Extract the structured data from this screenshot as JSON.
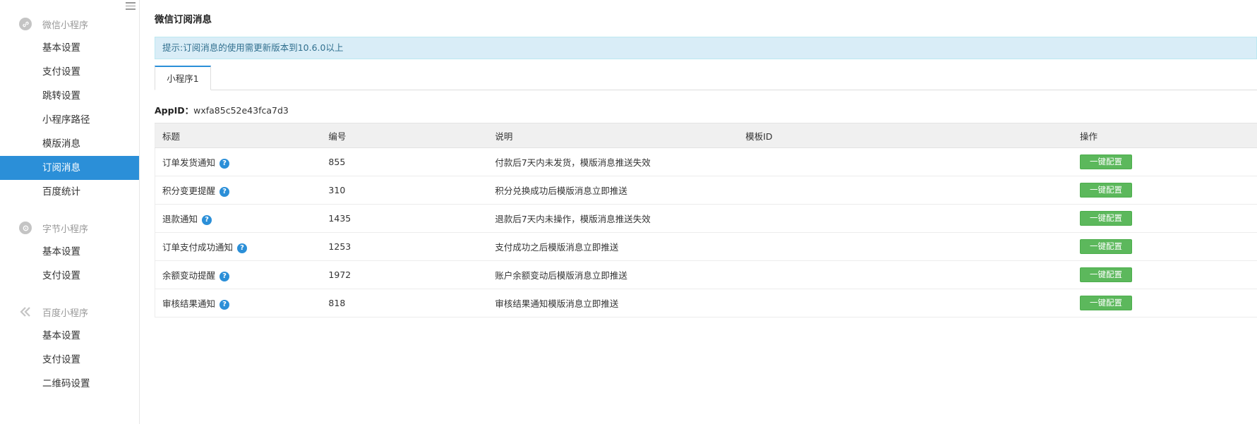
{
  "sidebar": {
    "groups": [
      {
        "title": "微信小程序",
        "icon": "link-icon",
        "items": [
          "基本设置",
          "支付设置",
          "跳转设置",
          "小程序路径",
          "模版消息",
          "订阅消息",
          "百度统计"
        ]
      },
      {
        "title": "字节小程序",
        "icon": "bytedance-icon",
        "items": [
          "基本设置",
          "支付设置"
        ]
      },
      {
        "title": "百度小程序",
        "icon": "baidu-chevron-icon",
        "items": [
          "基本设置",
          "支付设置",
          "二维码设置"
        ]
      }
    ],
    "active_item": "订阅消息"
  },
  "page": {
    "title": "微信订阅消息",
    "tip": "提示:订阅消息的使用需更新版本到10.6.0以上",
    "tabs": [
      "小程序1"
    ],
    "appid_label": "AppID：",
    "appid_value": "wxfa85c52e43fca7d3"
  },
  "table": {
    "headers": [
      "标题",
      "编号",
      "说明",
      "模板ID",
      "操作"
    ],
    "rows": [
      {
        "title": "订单发货通知",
        "id": "855",
        "desc": "付款后7天内未发货，模版消息推送失效",
        "template_id": "",
        "action": "一键配置"
      },
      {
        "title": "积分变更提醒",
        "id": "310",
        "desc": "积分兑换成功后模版消息立即推送",
        "template_id": "",
        "action": "一键配置"
      },
      {
        "title": "退款通知",
        "id": "1435",
        "desc": "退款后7天内未操作，模版消息推送失效",
        "template_id": "",
        "action": "一键配置"
      },
      {
        "title": "订单支付成功通知",
        "id": "1253",
        "desc": "支付成功之后模版消息立即推送",
        "template_id": "",
        "action": "一键配置"
      },
      {
        "title": "余额变动提醒",
        "id": "1972",
        "desc": "账户余额变动后模版消息立即推送",
        "template_id": "",
        "action": "一键配置"
      },
      {
        "title": "审核结果通知",
        "id": "818",
        "desc": "审核结果通知模版消息立即推送",
        "template_id": "",
        "action": "一键配置"
      }
    ],
    "help_glyph": "?"
  },
  "colors": {
    "accent": "#2b8fd8",
    "success": "#5cb85c",
    "tip_bg": "#d9edf7"
  }
}
